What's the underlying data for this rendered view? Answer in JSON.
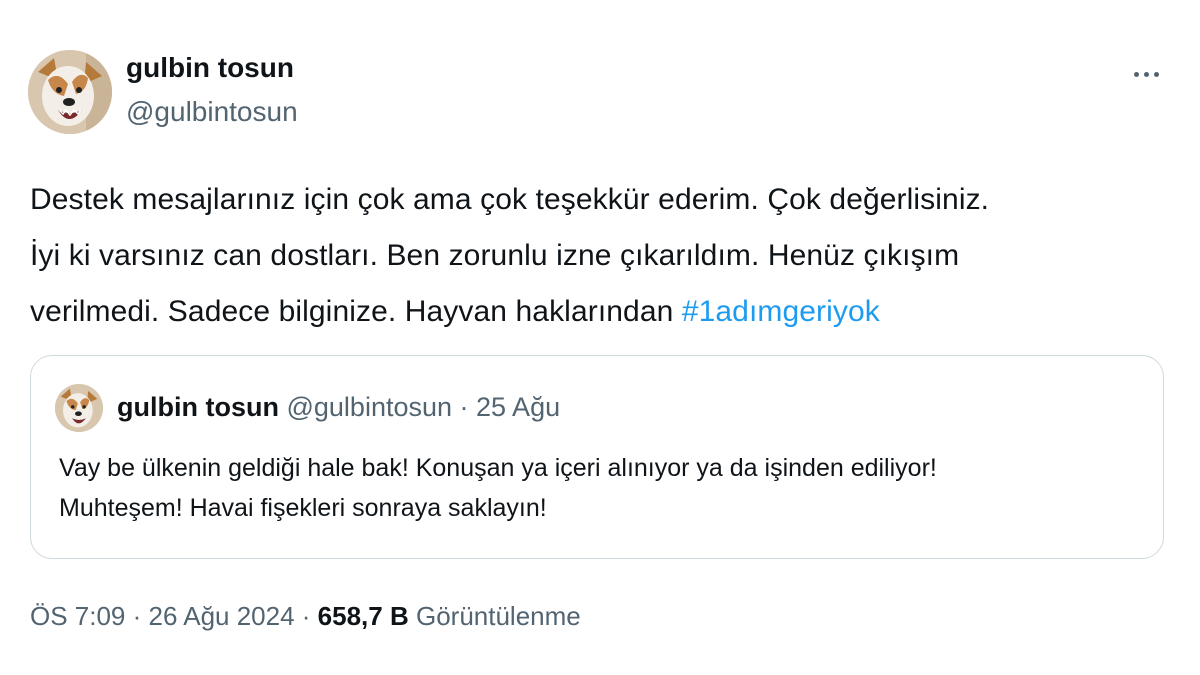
{
  "author": {
    "name": "gulbin tosun",
    "handle": "@gulbintosun"
  },
  "tweet": {
    "lines": [
      "Destek mesajlarınız için çok ama çok teşekkür ederim. Çok değerlisiniz.",
      "İyi ki varsınız can dostları. Ben zorunlu izne çıkarıldım. Henüz çıkışım",
      "verilmedi. Sadece bilginize. Hayvan haklarından "
    ],
    "hashtag": "#1adımgeriyok"
  },
  "quoted": {
    "name": "gulbin tosun",
    "handle": "@gulbintosun",
    "separator": " · ",
    "date": "25 Ağu",
    "lines": [
      "Vay be ülkenin geldiği hale bak! Konuşan ya içeri alınıyor ya da işinden ediliyor!",
      "Muhteşem! Havai fişekleri sonraya saklayın!"
    ]
  },
  "meta": {
    "time": "ÖS 7:09",
    "sep1": " · ",
    "date": "26 Ağu 2024",
    "sep2": " · ",
    "views_count": "658,7 B",
    "views_label": "Görüntülenme"
  },
  "icons": {
    "more": "more-horizontal-icon"
  },
  "colors": {
    "link": "#1d9bf0",
    "secondary_text": "#536471",
    "primary_text": "#0f1419",
    "border": "#cfd9de"
  }
}
